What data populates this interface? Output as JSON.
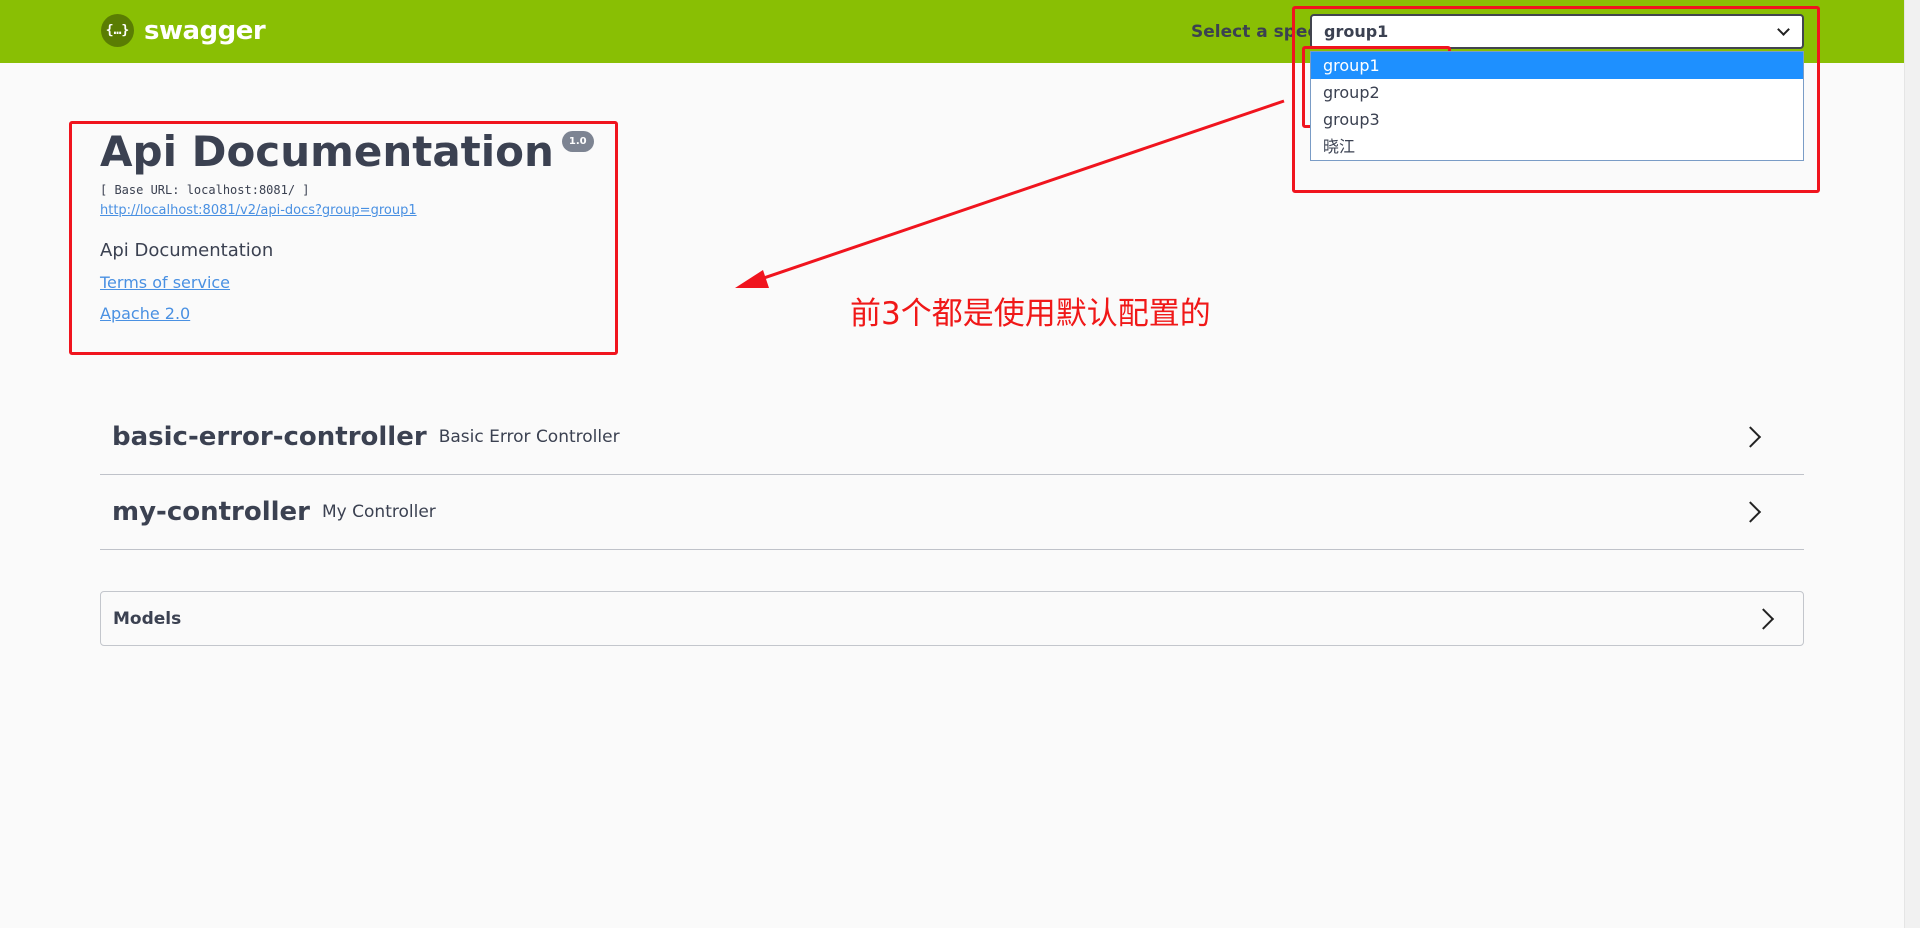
{
  "header": {
    "logo_text": "swagger",
    "logo_glyph": "{…}",
    "spec_label": "Select a spec",
    "selected_spec": "group1",
    "spec_options": [
      "group1",
      "group2",
      "group3",
      "晓江"
    ],
    "bar_color": "#89bf04"
  },
  "info": {
    "title": "Api Documentation",
    "version": "1.0",
    "base_url": "[ Base URL: localhost:8081/ ]",
    "spec_url": "http://localhost:8081/v2/api-docs?group=group1",
    "description": "Api Documentation",
    "terms_label": "Terms of service",
    "license_label": "Apache 2.0"
  },
  "tags": [
    {
      "name": "basic-error-controller",
      "description": "Basic Error Controller"
    },
    {
      "name": "my-controller",
      "description": "My Controller"
    }
  ],
  "models": {
    "label": "Models"
  },
  "annotation": {
    "text": "前3个都是使用默认配置的",
    "color": "#f0141e"
  }
}
